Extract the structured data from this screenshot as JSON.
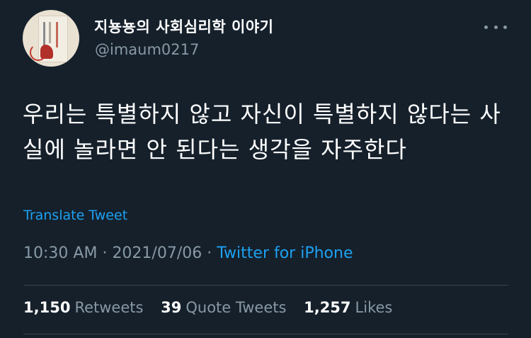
{
  "author": {
    "display_name": "지뇽뇽의 사회심리학 이야기",
    "handle": "@imaum0217"
  },
  "tweet": {
    "text": "우리는 특별하지 않고 자신이 특별하지 않다는 사실에 놀라면 안 된다는 생각을 자주한다",
    "translate_label": "Translate Tweet",
    "time": "10:30 AM",
    "date": "2021/07/06",
    "separator": "·",
    "source": "Twitter for iPhone"
  },
  "stats": {
    "retweets": {
      "count": "1,150",
      "label": "Retweets"
    },
    "quotes": {
      "count": "39",
      "label": "Quote Tweets"
    },
    "likes": {
      "count": "1,257",
      "label": "Likes"
    }
  },
  "icons": {
    "more": "more-dots-icon",
    "avatar": "avatar-book-image"
  },
  "colors": {
    "background": "#15202b",
    "accent": "#1da1f2",
    "secondary_text": "#8899a6",
    "divider": "#38444d"
  }
}
